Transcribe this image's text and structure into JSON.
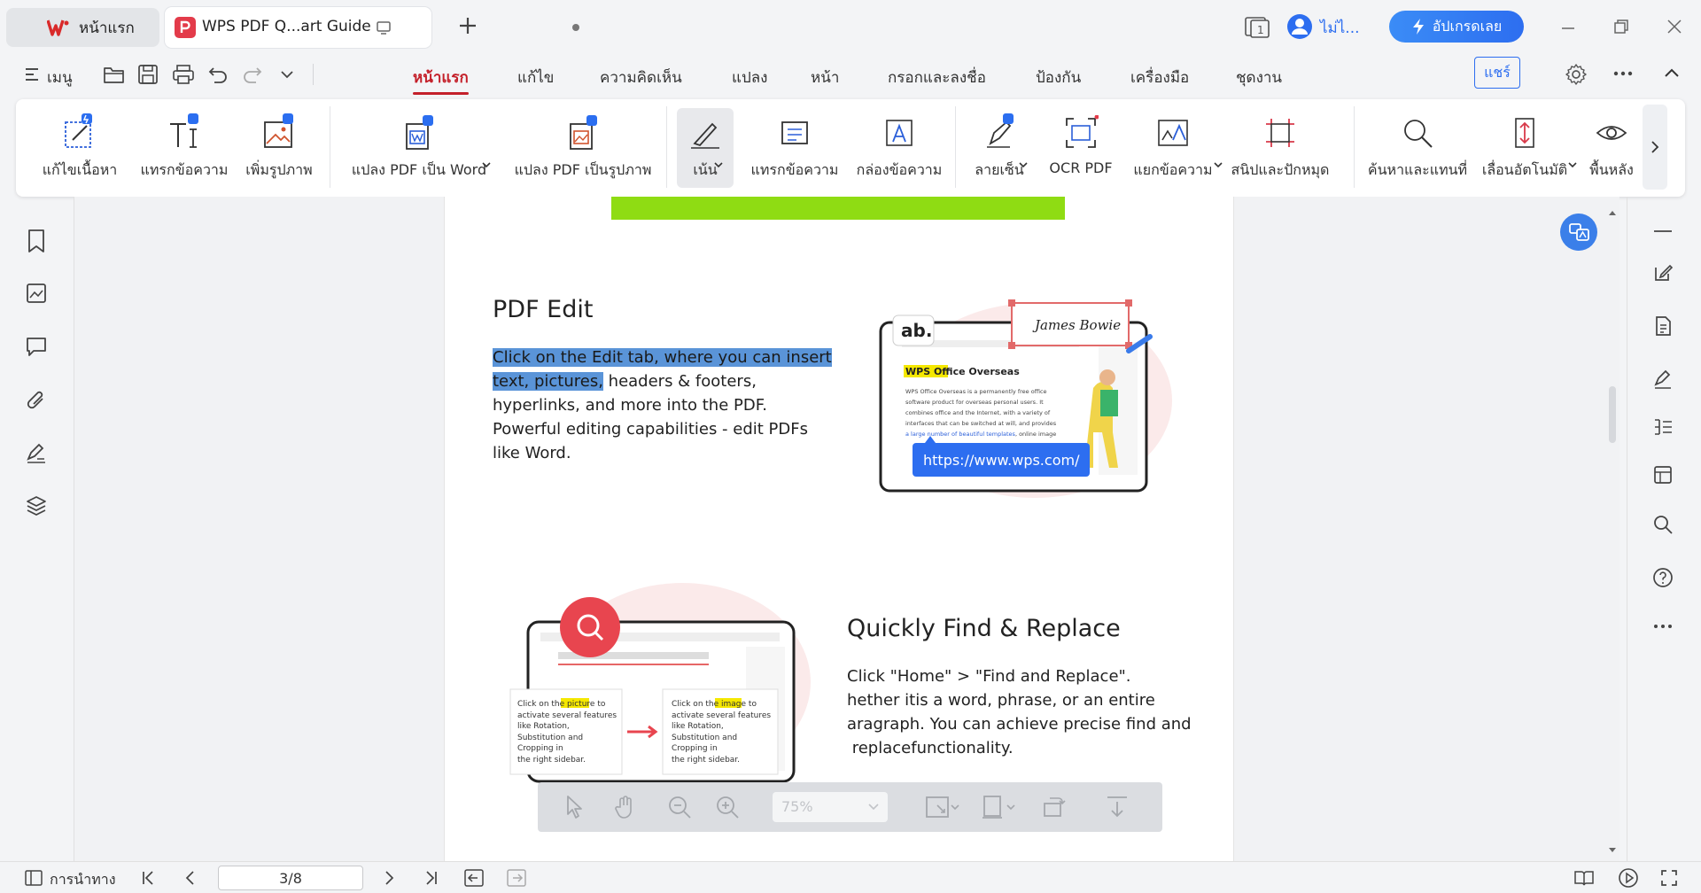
{
  "window": {
    "home_tab_label": "หน้าแรก",
    "doc_tab_label": "WPS PDF Q...art Guide",
    "user_label": "ไม่ไ...",
    "upgrade_label": "อัปเกรดเลย",
    "page_badge": "1"
  },
  "menubar": {
    "menu_label": "เมนู",
    "tabs": [
      "หน้าแรก",
      "แก้ไข",
      "ความคิดเห็น",
      "แปลง",
      "หน้า",
      "กรอกและลงชื่อ",
      "ป้องกัน",
      "เครื่องมือ",
      "ชุดงาน"
    ],
    "active_tab": "หน้าแรก",
    "share_label": "แชร์"
  },
  "ribbon": {
    "edit_content": "แก้ไขเนื้อหา",
    "insert_text": "แทรกข้อความ",
    "add_image": "เพิ่มรูปภาพ",
    "pdf_to_word": "แปลง PDF เป็น Word",
    "pdf_to_image": "แปลง PDF เป็นรูปภาพ",
    "highlight": "เน้น",
    "insert_text2": "แทรกข้อความ",
    "text_box": "กล่องข้อความ",
    "signature": "ลายเซ็น",
    "ocr": "OCR PDF",
    "extract_text": "แยกข้อความ",
    "snip_pin": "สนิปและปักหมุด",
    "find_replace": "ค้นหาและแทนที่",
    "auto_scroll": "เลื่อนอัตโนมัติ",
    "background": "พื้นหลัง"
  },
  "document": {
    "edit_heading": "PDF Edit",
    "edit_highlight_1": "Click on the Edit tab, where you can insert",
    "edit_highlight_2": "text, pictures,",
    "edit_rest_1": " headers & footers,",
    "edit_rest_2": "hyperlinks, and more into the PDF.",
    "edit_rest_3": "Powerful editing capabilities - edit PDFs",
    "edit_rest_4": "like Word.",
    "find_heading": "Quickly Find & Replace",
    "find_line_1": "Click \"Home\" > \"Find and Replace\".",
    "find_line_2": "hether itis a word, phrase, or an entire",
    "find_line_3": "aragraph. You can achieve precise find and",
    "find_line_4": " replacefunctionality.",
    "illus1": {
      "ab": "ab.",
      "signature": "James Bowie",
      "wps_title_hl": "WPS Office",
      "wps_title_rest": " Overseas",
      "body_1": "WPS Office Overseas is a permanently free office",
      "body_2": "software product for overseas personal users. It",
      "body_3": "combines office and the Internet, with a variety of",
      "body_4": "interfaces that can be switched at will, and provides",
      "link": "a large number of beautiful templates",
      "body_5": ", online image",
      "url": "https://www.wps.com/"
    },
    "illus2": {
      "card1_a": "Click on the ",
      "card1_hl": "picture",
      "card1_b": " to",
      "card2_a": "Click on the ",
      "card2_hl": "image",
      "card2_b": " to",
      "card_l2": "activate several features",
      "card_l3": "like Rotation,",
      "card_l4": "Substitution and",
      "card_l5": "Cropping in",
      "card_l6": "the right sidebar."
    }
  },
  "floatbar": {
    "zoom": "75%"
  },
  "statusbar": {
    "nav_label": "การนำทาง",
    "page": "3/8"
  },
  "colors": {
    "accent_red": "#c4202a",
    "accent_blue": "#2d6ef0",
    "highlight_blue": "#5a94d8",
    "green_bar": "#8fdc13"
  }
}
